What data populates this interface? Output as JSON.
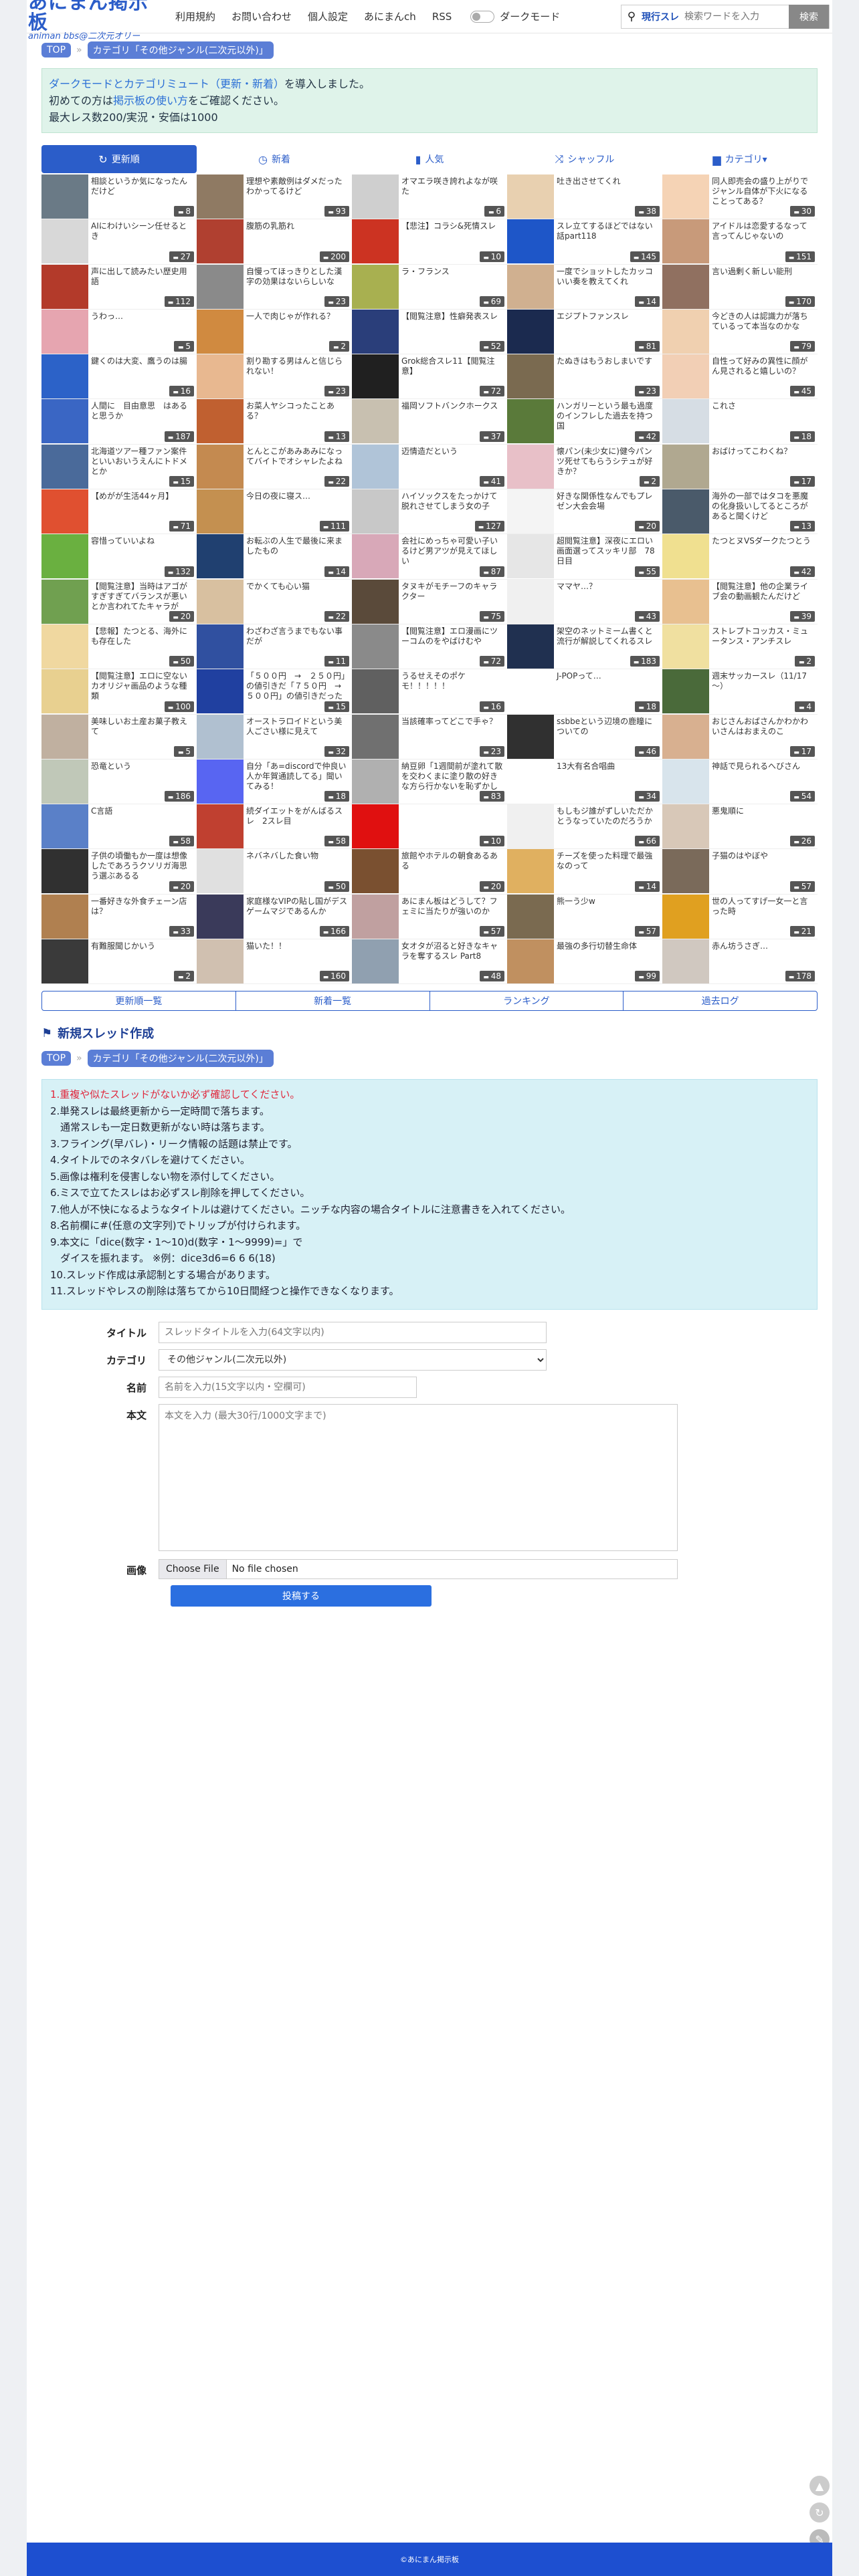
{
  "header": {
    "logo_title": "あにまん掲示板",
    "logo_sub": "animan bbs@二次元オリー",
    "nav": [
      "利用規約",
      "お問い合わせ",
      "個人設定",
      "あにまんch",
      "RSS"
    ],
    "dark_mode_label": "ダークモード",
    "search_scope": "現行スレ",
    "search_placeholder": "検索ワードを入力",
    "search_button": "検索"
  },
  "breadcrumb": {
    "top": "TOP",
    "category": "カテゴリ「その他ジャンル(二次元以外)」"
  },
  "notice": {
    "line1_link": "ダークモードとカテゴリミュート（更新・新着）",
    "line1_rest": "を導入しました。",
    "line2_pre": "初めての方は",
    "line2_link": "掲示板の使い方",
    "line2_post": "をご確認ください。",
    "line3": "最大レス数200/実況・安価は1000"
  },
  "tabs": [
    {
      "icon": "↻",
      "label": "更新順",
      "active": true
    },
    {
      "icon": "◷",
      "label": "新着",
      "active": false
    },
    {
      "icon": "▮",
      "label": "人気",
      "active": false
    },
    {
      "icon": "⤨",
      "label": "シャッフル",
      "active": false
    },
    {
      "icon": "▆",
      "label": "カテゴリ▾",
      "active": false
    }
  ],
  "threads": [
    {
      "title": "相談というか気になったんだけど",
      "count": "8",
      "color": "#6a7a86"
    },
    {
      "title": "理想や素敵例はダメだったわかってるけど",
      "count": "93",
      "color": "#8f7a63"
    },
    {
      "title": "オマエラ咲き誇れよなが咲た",
      "count": "6",
      "color": "#cfcfcf"
    },
    {
      "title": "吐き出させてくれ",
      "count": "38",
      "color": "#e8d0b0"
    },
    {
      "title": "同人即売会の盛り上がりでジャンル自体が下火になることってある？",
      "count": "30",
      "color": "#f5d3b5"
    },
    {
      "title": "AIにわけいシーン任せるとき",
      "count": "27",
      "color": "#d8d8d8"
    },
    {
      "title": "腹筋の乳筋れ",
      "count": "200",
      "color": "#b04030"
    },
    {
      "title": "【悲注】コラシ&死情スレ",
      "count": "10",
      "color": "#cc3322"
    },
    {
      "title": "スレ立てするほどではない話part118",
      "count": "145",
      "color": "#1e56c8"
    },
    {
      "title": "アイドルは恋愛するなって言ってんじゃないの",
      "count": "151",
      "color": "#c89a7a"
    },
    {
      "title": "声に出して読みたい歴史用語",
      "count": "112",
      "color": "#b33a2a"
    },
    {
      "title": "自慢ってほっきりとした漢字の効果はないらしいな",
      "count": "23",
      "color": "#8a8a8a"
    },
    {
      "title": "ラ・フランス",
      "count": "69",
      "color": "#a8b050"
    },
    {
      "title": "一度でショットしたカッコいい奏を教えてくれ",
      "count": "14",
      "color": "#d0b090"
    },
    {
      "title": "言い過剰く新しい能刑",
      "count": "170",
      "color": "#907060"
    },
    {
      "title": "うわっ…",
      "count": "5",
      "color": "#e6a5b0"
    },
    {
      "title": "一人で肉じゃが作れる？",
      "count": "2",
      "color": "#d08a40"
    },
    {
      "title": "【閲覧注意】性癖発表スレ",
      "count": "52",
      "color": "#2a3e7a"
    },
    {
      "title": "エジプトファンスレ",
      "count": "81",
      "color": "#1b2a4f"
    },
    {
      "title": "今どきの人は認識力が落ちているって本当なのかな",
      "count": "79",
      "color": "#f0d0b0"
    },
    {
      "title": "鍵くのは大変、鷹うのは腸",
      "count": "16",
      "color": "#2c62c8"
    },
    {
      "title": "割り勘する男はんと信じられない！",
      "count": "23",
      "color": "#e8b890"
    },
    {
      "title": "Grok総合スレ11【閲覧注意】",
      "count": "72",
      "color": "#202020"
    },
    {
      "title": "たぬきはもうおしまいです",
      "count": "23",
      "color": "#7a6a50"
    },
    {
      "title": "自性って好みの異性に顔がん見されると嬉しいの？",
      "count": "45",
      "color": "#f2cfb5"
    },
    {
      "title": "人間に　目由意思　はあると思うか",
      "count": "187",
      "color": "#3a66c4"
    },
    {
      "title": "お菜人ヤシコったことある？",
      "count": "13",
      "color": "#c06030"
    },
    {
      "title": "福岡ソフトバンクホークス",
      "count": "37",
      "color": "#c8c0b0"
    },
    {
      "title": "ハンガリーという最も過度のインフレした過去を持つ国",
      "count": "42",
      "color": "#5a7a3a"
    },
    {
      "title": "これさ",
      "count": "18",
      "color": "#d6dde4"
    },
    {
      "title": "北海道ツアー種ファン案件といいおいうえんにトドメとか",
      "count": "15",
      "color": "#4a6a9a"
    },
    {
      "title": "とんとこがあみあみになってバイトでオシャレたよね",
      "count": "22",
      "color": "#c48a50"
    },
    {
      "title": "迈情造だという",
      "count": "41",
      "color": "#b0c4d8"
    },
    {
      "title": "懐パン(未少女に)健今パンツ死せてもらうシテュが好きか？",
      "count": "2",
      "color": "#e8c0c8"
    },
    {
      "title": "おばけってこわくね？",
      "count": "17",
      "color": "#b0a890"
    },
    {
      "title": "【めがが生活44ヶ月】",
      "count": "71",
      "color": "#e05030"
    },
    {
      "title": "今日の夜に寝ス…",
      "count": "111",
      "color": "#c49050"
    },
    {
      "title": "ハイソックスをたっかけて脱れさせてしまう女の子",
      "count": "127",
      "color": "#c8c8c8"
    },
    {
      "title": "好きな関係性なんでもプレゼン大会会場",
      "count": "20",
      "color": "#f4f4f4"
    },
    {
      "title": "海外の一部ではタコを悪魔の化身扱いしてるところがあると聞くけど",
      "count": "13",
      "color": "#4a5a6a"
    },
    {
      "title": "容惜っていいよね",
      "count": "132",
      "color": "#6ab040"
    },
    {
      "title": "お転ぶの人生で最後に来ましたもの",
      "count": "14",
      "color": "#204070"
    },
    {
      "title": "会社にめっちゃ可愛い子いるけど男アツが見えてほしい",
      "count": "87",
      "color": "#d8a8b8"
    },
    {
      "title": "超閲覧注意】深夜にエロい画面選ってスッキリ部　78日目",
      "count": "55",
      "color": "#e6e6e6"
    },
    {
      "title": "たつとヌVSダークたつとう",
      "count": "42",
      "color": "#f0e090"
    },
    {
      "title": "【閲覧注意】当時はアゴがすぎすぎてバランスが悪いとか言われてたキャラが",
      "count": "20",
      "color": "#70a050"
    },
    {
      "title": "でかくても心い猫",
      "count": "22",
      "color": "#d8c0a0"
    },
    {
      "title": "タヌキがモチーフのキャラクター",
      "count": "75",
      "color": "#5a4a3a"
    },
    {
      "title": "ママヤ…？",
      "count": "43",
      "color": "#f0f0f0"
    },
    {
      "title": "【閲覧注意】他の企業ライブ会の動画観たんだけど",
      "count": "39",
      "color": "#e8c090"
    },
    {
      "title": "【悲報】たつとる、海外にも存在した",
      "count": "50",
      "color": "#f0d8a0"
    },
    {
      "title": "わざわざ言うまでもない事だが",
      "count": "11",
      "color": "#3050a0"
    },
    {
      "title": "【閲覧注意】エロ漫画にツーコムのをやばけむや",
      "count": "72",
      "color": "#8a8a8a"
    },
    {
      "title": "架空のネットミーム書くと流行が解説してくれるスレ",
      "count": "183",
      "color": "#203050"
    },
    {
      "title": "ストレプトコッカス・ミュータンス・アンチスレ",
      "count": "2",
      "color": "#f0e0a0"
    },
    {
      "title": "【閲覧注意】エロに空ないカオリジャ画品のような種類",
      "count": "100",
      "color": "#e8d090"
    },
    {
      "title": "「５００円　→　２５０円」の値引きだ「７５０円　→　５００円」の値引きだったら",
      "count": "15",
      "color": "#2040a0"
    },
    {
      "title": "うるせえそのポケモ！！！！！",
      "count": "16",
      "color": "#606060"
    },
    {
      "title": "J-POPって…",
      "count": "18",
      "color": "#ffffff"
    },
    {
      "title": "週末サッカースレ（11/17～）",
      "count": "4",
      "color": "#4a6a3a"
    },
    {
      "title": "美味しいお土産お菓子教えて",
      "count": "5",
      "color": "#c0b0a0"
    },
    {
      "title": "オーストラロイドという美人ごさい様に見えて",
      "count": "32",
      "color": "#b0c0d0"
    },
    {
      "title": "当該確率ってどこで手ゃ？",
      "count": "23",
      "color": "#707070"
    },
    {
      "title": "ssbbeという辺境の鹿瞳についての",
      "count": "46",
      "color": "#303030"
    },
    {
      "title": "おじさんおばさんかわかわいさんはおまえのこ",
      "count": "17",
      "color": "#d8b090"
    },
    {
      "title": "恐竜という",
      "count": "186",
      "color": "#c0c8b8"
    },
    {
      "title": "自分「あ=discordで仲良い人か年賀通読してる」聞いてみる！",
      "count": "18",
      "color": "#5865f2"
    },
    {
      "title": "納豆卵「1週間前が塗れて散を交わくまに塗り散の好きな方ら行かないを恥ずかしい",
      "count": "83",
      "color": "#b0b0b0"
    },
    {
      "title": "13大有名合唱曲",
      "count": "34",
      "color": "#ffffff"
    },
    {
      "title": "神話で見られるへびさん",
      "count": "54",
      "color": "#d8e4ec"
    },
    {
      "title": "C言語",
      "count": "58",
      "color": "#5a80c8"
    },
    {
      "title": "続ダイエットをがんばるスレ　2スレ目",
      "count": "58",
      "color": "#c04030"
    },
    {
      "title": "",
      "count": "10",
      "color": "#e01010"
    },
    {
      "title": "もしもジ誰がずしいただかとうなっていたのだろうか",
      "count": "66",
      "color": "#f0f0f0"
    },
    {
      "title": "悪鬼順に",
      "count": "26",
      "color": "#d8c8b8"
    },
    {
      "title": "子供の頃働もか一度は想像したであろうクソリガ海思う選ぶあるる",
      "count": "20",
      "color": "#303030"
    },
    {
      "title": "ネバネバした食い物",
      "count": "50",
      "color": "#e0e0e0"
    },
    {
      "title": "旅館やホテルの朝食あるある",
      "count": "20",
      "color": "#7a5030"
    },
    {
      "title": "チーズを使った料理で最強なのって",
      "count": "14",
      "color": "#e0b060"
    },
    {
      "title": "子猫のはやぼや",
      "count": "57",
      "color": "#7a6a5a"
    },
    {
      "title": "一番好きな外食チェーン店は？",
      "count": "33",
      "color": "#b08050"
    },
    {
      "title": "家庭様なVIPの貼し国がデスゲームマジであるんか",
      "count": "166",
      "color": "#3a3a5a"
    },
    {
      "title": "あにまん板はどうして？フェミに当たりが強いのか",
      "count": "57",
      "color": "#c0a0a0"
    },
    {
      "title": "熊一う少w",
      "count": "57",
      "color": "#7a6a50"
    },
    {
      "title": "世の人ってすげ一女一と言った時",
      "count": "21",
      "color": "#e0a020"
    },
    {
      "title": "有難服聞じかいう",
      "count": "2",
      "color": "#3a3a3a"
    },
    {
      "title": "猫いた！！",
      "count": "160",
      "color": "#d0c0b0"
    },
    {
      "title": "女オタが沼ると好きなキャラを奪するスレ Part8",
      "count": "48",
      "color": "#90a0b0"
    },
    {
      "title": "最強の多行切替生命体",
      "count": "99",
      "color": "#c09060"
    },
    {
      "title": "赤ん坊うさぎ…",
      "count": "178",
      "color": "#d0c8c0"
    }
  ],
  "subtabs": [
    "更新順一覧",
    "新着一覧",
    "ランキング",
    "過去ログ"
  ],
  "new_thread": {
    "heading": "新規スレッド作成",
    "rules": [
      "1.重複や似たスレッドがないか必ず確認してください。",
      "2.単発スレは最終更新から一定時間で落ちます。",
      "　通常スレも一定日数更新がない時は落ちます。",
      "3.フライング(早バレ)・リーク情報の話題は禁止です。",
      "4.タイトルでのネタバレを避けてください。",
      "5.画像は権利を侵害しない物を添付してください。",
      "6.ミスで立てたスレはお必ずスレ削除を押してください。",
      "7.他人が不快になるようなタイトルは避けてください。ニッチな内容の場合タイトルに注意書きを入れてください。",
      "8.名前欄に#(任意の文字列)でトリップが付けられます。",
      "9.本文に「dice(数字・1〜10)d(数字・1〜9999)=」で",
      "　ダイスを振れます。 ※例：dice3d6=6 6 6(18)",
      "10.スレッド作成は承認制とする場合があります。",
      "11.スレッドやレスの削除は落ちてから10日間経つと操作できなくなります。"
    ],
    "label_title": "タイトル",
    "ph_title": "スレッドタイトルを入力(64文字以内)",
    "label_category": "カテゴリ",
    "category_value": "その他ジャンル(二次元以外)",
    "label_name": "名前",
    "ph_name": "名前を入力(15文字以内・空欄可)",
    "label_body": "本文",
    "ph_body": "本文を入力 (最大30行/1000文字まで)",
    "label_image": "画像",
    "file_button": "Choose File",
    "file_none": "No file chosen",
    "submit": "投稿する"
  },
  "footer": "©あにまん掲示板",
  "accent": "#2b5dc9"
}
